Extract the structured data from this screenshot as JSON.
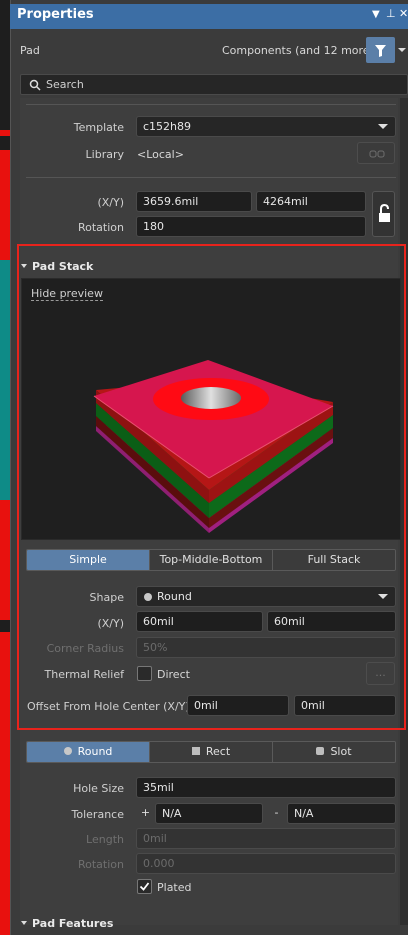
{
  "panel": {
    "title": "Properties",
    "object_type": "Pad",
    "filter_text": "Components (and 12 more)",
    "search_placeholder": "Search"
  },
  "template": {
    "label": "Template",
    "value": "c152h89"
  },
  "library": {
    "label": "Library",
    "value": "<Local>"
  },
  "location": {
    "xy_label": "(X/Y)",
    "x": "3659.6mil",
    "y": "4264mil",
    "rotation_label": "Rotation",
    "rotation": "180"
  },
  "pad_stack": {
    "title": "Pad Stack",
    "hide_preview": "Hide preview",
    "tabs": [
      "Simple",
      "Top-Middle-Bottom",
      "Full Stack"
    ],
    "active_tab": 0,
    "shape_label": "Shape",
    "shape_value": "Round",
    "size_label": "(X/Y)",
    "size_x": "60mil",
    "size_y": "60mil",
    "corner_radius_label": "Corner Radius",
    "corner_radius": "50%",
    "thermal_relief_label": "Thermal Relief",
    "thermal_relief_value": "Direct",
    "more_button": "...",
    "offset_label": "Offset From Hole Center (X/Y)",
    "offset_x": "0mil",
    "offset_y": "0mil"
  },
  "hole": {
    "types": [
      "Round",
      "Rect",
      "Slot"
    ],
    "active_type": 0,
    "size_label": "Hole Size",
    "size": "35mil",
    "tolerance_label": "Tolerance",
    "tol_plus": "+",
    "tol_plus_value": "N/A",
    "tol_minus": "-",
    "tol_minus_value": "N/A",
    "length_label": "Length",
    "length": "0mil",
    "rotation_label": "Rotation",
    "rotation": "0.000",
    "plated_label": "Plated",
    "plated": true
  },
  "pad_features": {
    "title": "Pad Features"
  },
  "colors": {
    "accent": "#3c6ea5",
    "highlight_border": "#e8231c",
    "pad_top": "#d6164e",
    "pad_hole_ring": "#ff0a14"
  }
}
